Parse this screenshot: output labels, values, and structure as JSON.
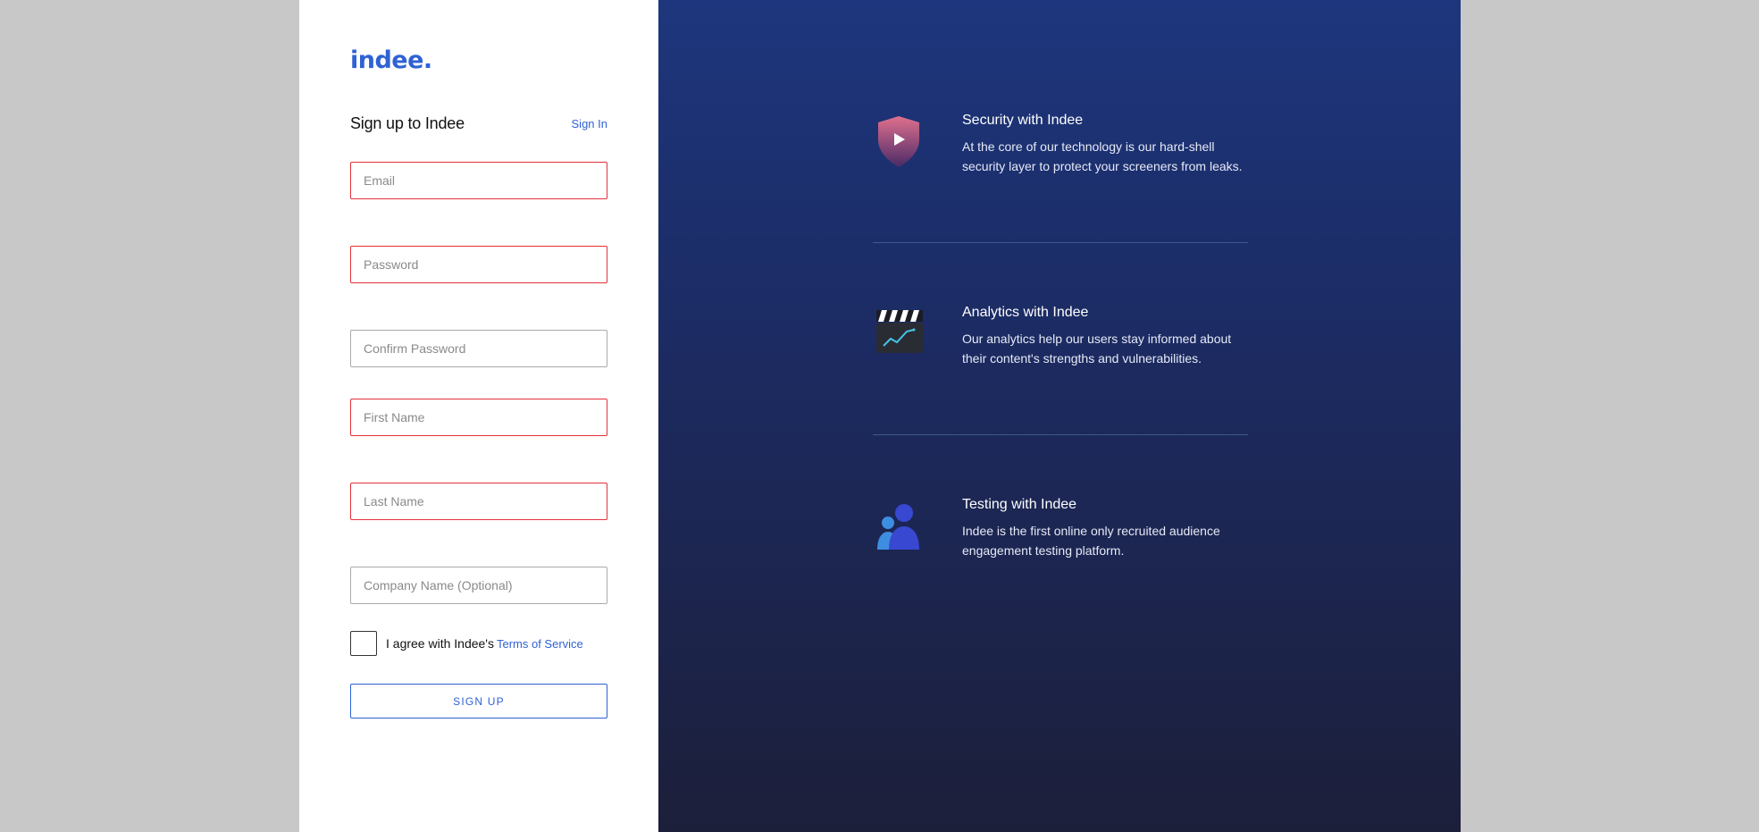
{
  "logo": {
    "text": "indee."
  },
  "form": {
    "title": "Sign up to Indee",
    "signin_label": "Sign In",
    "fields": {
      "email": {
        "placeholder": "Email"
      },
      "password": {
        "placeholder": "Password"
      },
      "confirm_password": {
        "placeholder": "Confirm Password"
      },
      "first_name": {
        "placeholder": "First Name"
      },
      "last_name": {
        "placeholder": "Last Name"
      },
      "company": {
        "placeholder": "Company Name (Optional)"
      }
    },
    "agree_text": "I agree with Indee's",
    "terms_label": "Terms of Service",
    "signup_label": "SIGN UP"
  },
  "features": [
    {
      "icon": "shield-play-icon",
      "title": "Security with Indee",
      "desc_line1": "At the core of our technology is our hard-shell",
      "desc_line2": "security layer to protect your screeners from leaks."
    },
    {
      "icon": "clapperboard-chart-icon",
      "title": "Analytics with Indee",
      "desc_line1": "Our analytics help our users stay informed about",
      "desc_line2": "their content's strengths and vulnerabilities."
    },
    {
      "icon": "audience-users-icon",
      "title": "Testing with Indee",
      "desc_line1": "Indee is the first online only recruited audience",
      "desc_line2": "engagement testing platform."
    }
  ],
  "colors": {
    "brand": "#2f62d3",
    "error_border": "#e5303a",
    "background": "#c8c8c8",
    "panel_top": "#1d367d",
    "panel_bottom": "#1c1f3a"
  }
}
